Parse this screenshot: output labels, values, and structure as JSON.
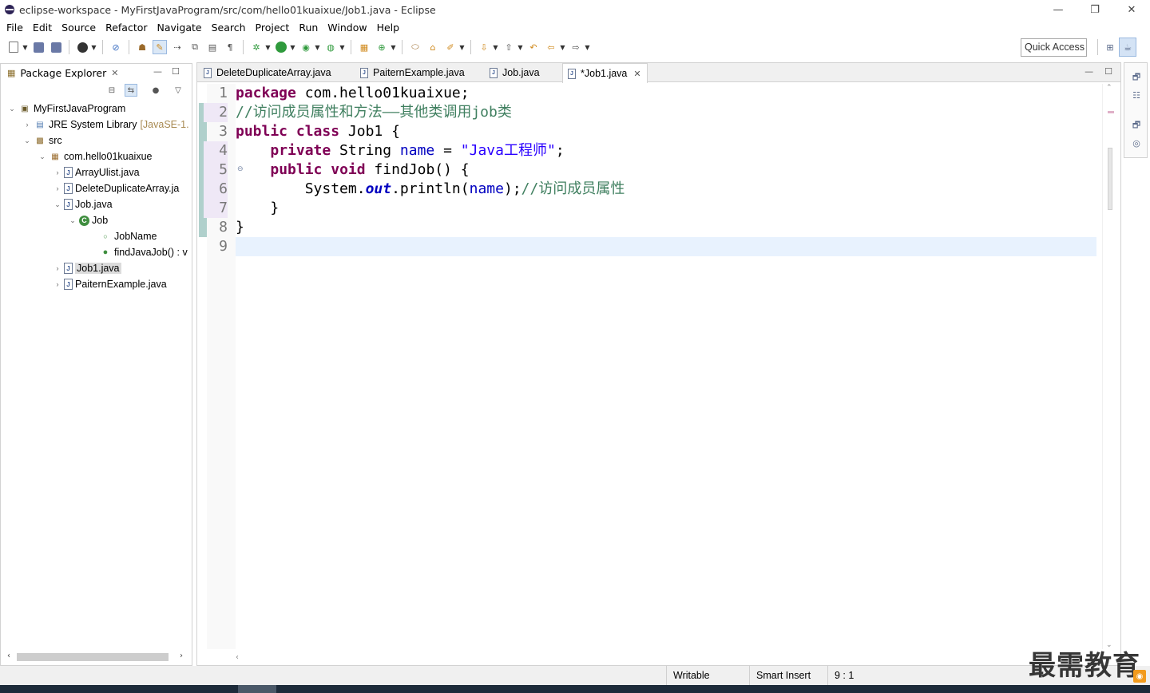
{
  "window": {
    "title": "eclipse-workspace - MyFirstJavaProgram/src/com/hello01kuaixue/Job1.java - Eclipse",
    "minimize": "—",
    "restore": "❐",
    "close": "✕"
  },
  "menu": [
    "File",
    "Edit",
    "Source",
    "Refactor",
    "Navigate",
    "Search",
    "Project",
    "Run",
    "Window",
    "Help"
  ],
  "toolbar": {
    "quick_access": "Quick Access"
  },
  "package_explorer": {
    "title": "Package Explorer",
    "tree": [
      {
        "label": "MyFirstJavaProgram",
        "decoration": ""
      },
      {
        "label": "JRE System Library",
        "decoration": "[JavaSE-1."
      },
      {
        "label": "src",
        "decoration": ""
      },
      {
        "label": "com.hello01kuaixue",
        "decoration": ""
      },
      {
        "label": "ArrayUlist.java",
        "decoration": ""
      },
      {
        "label": "DeleteDuplicateArray.ja",
        "decoration": ""
      },
      {
        "label": "Job.java",
        "decoration": ""
      },
      {
        "label": "Job",
        "decoration": ""
      },
      {
        "label": "JobName",
        "decoration": ""
      },
      {
        "label": "findJavaJob() : v",
        "decoration": ""
      },
      {
        "label": "Job1.java",
        "decoration": ""
      },
      {
        "label": "PaiternExample.java",
        "decoration": ""
      }
    ]
  },
  "editor": {
    "tabs": [
      {
        "label": "DeleteDuplicateArray.java"
      },
      {
        "label": "PaiternExample.java"
      },
      {
        "label": "Job.java"
      },
      {
        "label": "*Job1.java"
      }
    ],
    "line_numbers": [
      "1",
      "2",
      "3",
      "4",
      "5",
      "6",
      "7",
      "8",
      "9"
    ],
    "code": {
      "l1_kw": "package",
      "l1_rest": " com.hello01kuaixue;",
      "l2_comment": "//访问成员属性和方法——其他类调用job类",
      "l3_kw1": "public",
      "l3_kw2": "class",
      "l3_rest": " Job1 {",
      "l4_indent": "    ",
      "l4_kw": "private",
      "l4_type": " String ",
      "l4_field": "name",
      "l4_eq": " = ",
      "l4_str": "\"Java工程师\"",
      "l4_end": ";",
      "l5_indent": "    ",
      "l5_kw1": "public",
      "l5_kw2": "void",
      "l5_rest": " findJob() {",
      "l6_pre": "        System.",
      "l6_static": "out",
      "l6_mid": ".println(",
      "l6_field": "name",
      "l6_end": ");",
      "l6_comment": "//访问成员属性",
      "l7": "    }",
      "l8": "}"
    }
  },
  "status": {
    "writable": "Writable",
    "insert_mode": "Smart Insert",
    "position": "9 : 1"
  },
  "watermark": "最需教育"
}
